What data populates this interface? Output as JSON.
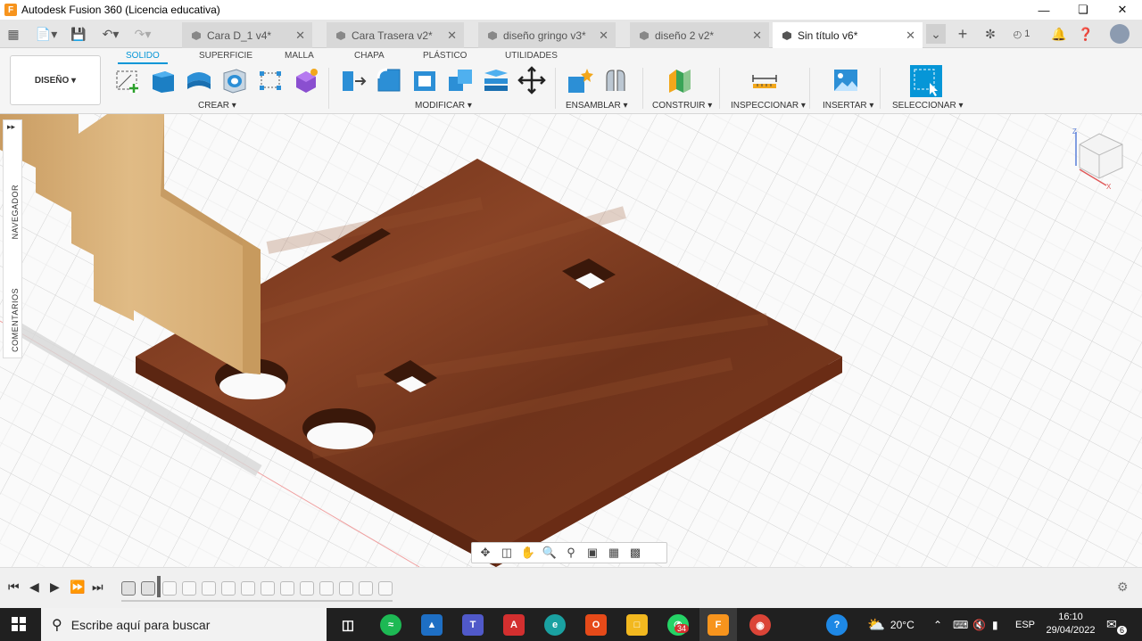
{
  "window": {
    "title": "Autodesk Fusion 360 (Licencia educativa)",
    "logo": "F"
  },
  "tabs": [
    {
      "label": "Cara D_1 v4*"
    },
    {
      "label": "Cara Trasera v2*"
    },
    {
      "label": "diseño gringo v3*"
    },
    {
      "label": "diseño 2 v2*"
    },
    {
      "label": "Sin título v6*"
    }
  ],
  "topbar": {
    "jobs_count": "1"
  },
  "ribbon": {
    "workspace": "DISEÑO ▾",
    "tabs": [
      "SOLIDO",
      "SUPERFICIE",
      "MALLA",
      "CHAPA",
      "PLÁSTICO",
      "UTILIDADES"
    ],
    "groups": [
      "CREAR ▾",
      "MODIFICAR ▾",
      "ENSAMBLAR ▾",
      "CONSTRUIR ▾",
      "INSPECCIONAR ▾",
      "INSERTAR ▾",
      "SELECCIONAR ▾"
    ]
  },
  "side_panel": {
    "browser_label": "NAVEGADOR",
    "comments_label": "COMENTARIOS",
    "expand": "▸▸"
  },
  "viewcube": {
    "axis_x": "X",
    "axis_z": "Z"
  },
  "taskbar": {
    "search_placeholder": "Escribe aquí para buscar",
    "whatsapp_badge": "34",
    "weather": "20°C",
    "language": "ESP",
    "time": "16:10",
    "date": "29/04/2022",
    "notif_count": "6"
  },
  "colors": {
    "accent": "#0696d7",
    "wood_dark": "#7a3a1e",
    "wood_light": "#dbb47e",
    "taskbar": "#202020"
  }
}
